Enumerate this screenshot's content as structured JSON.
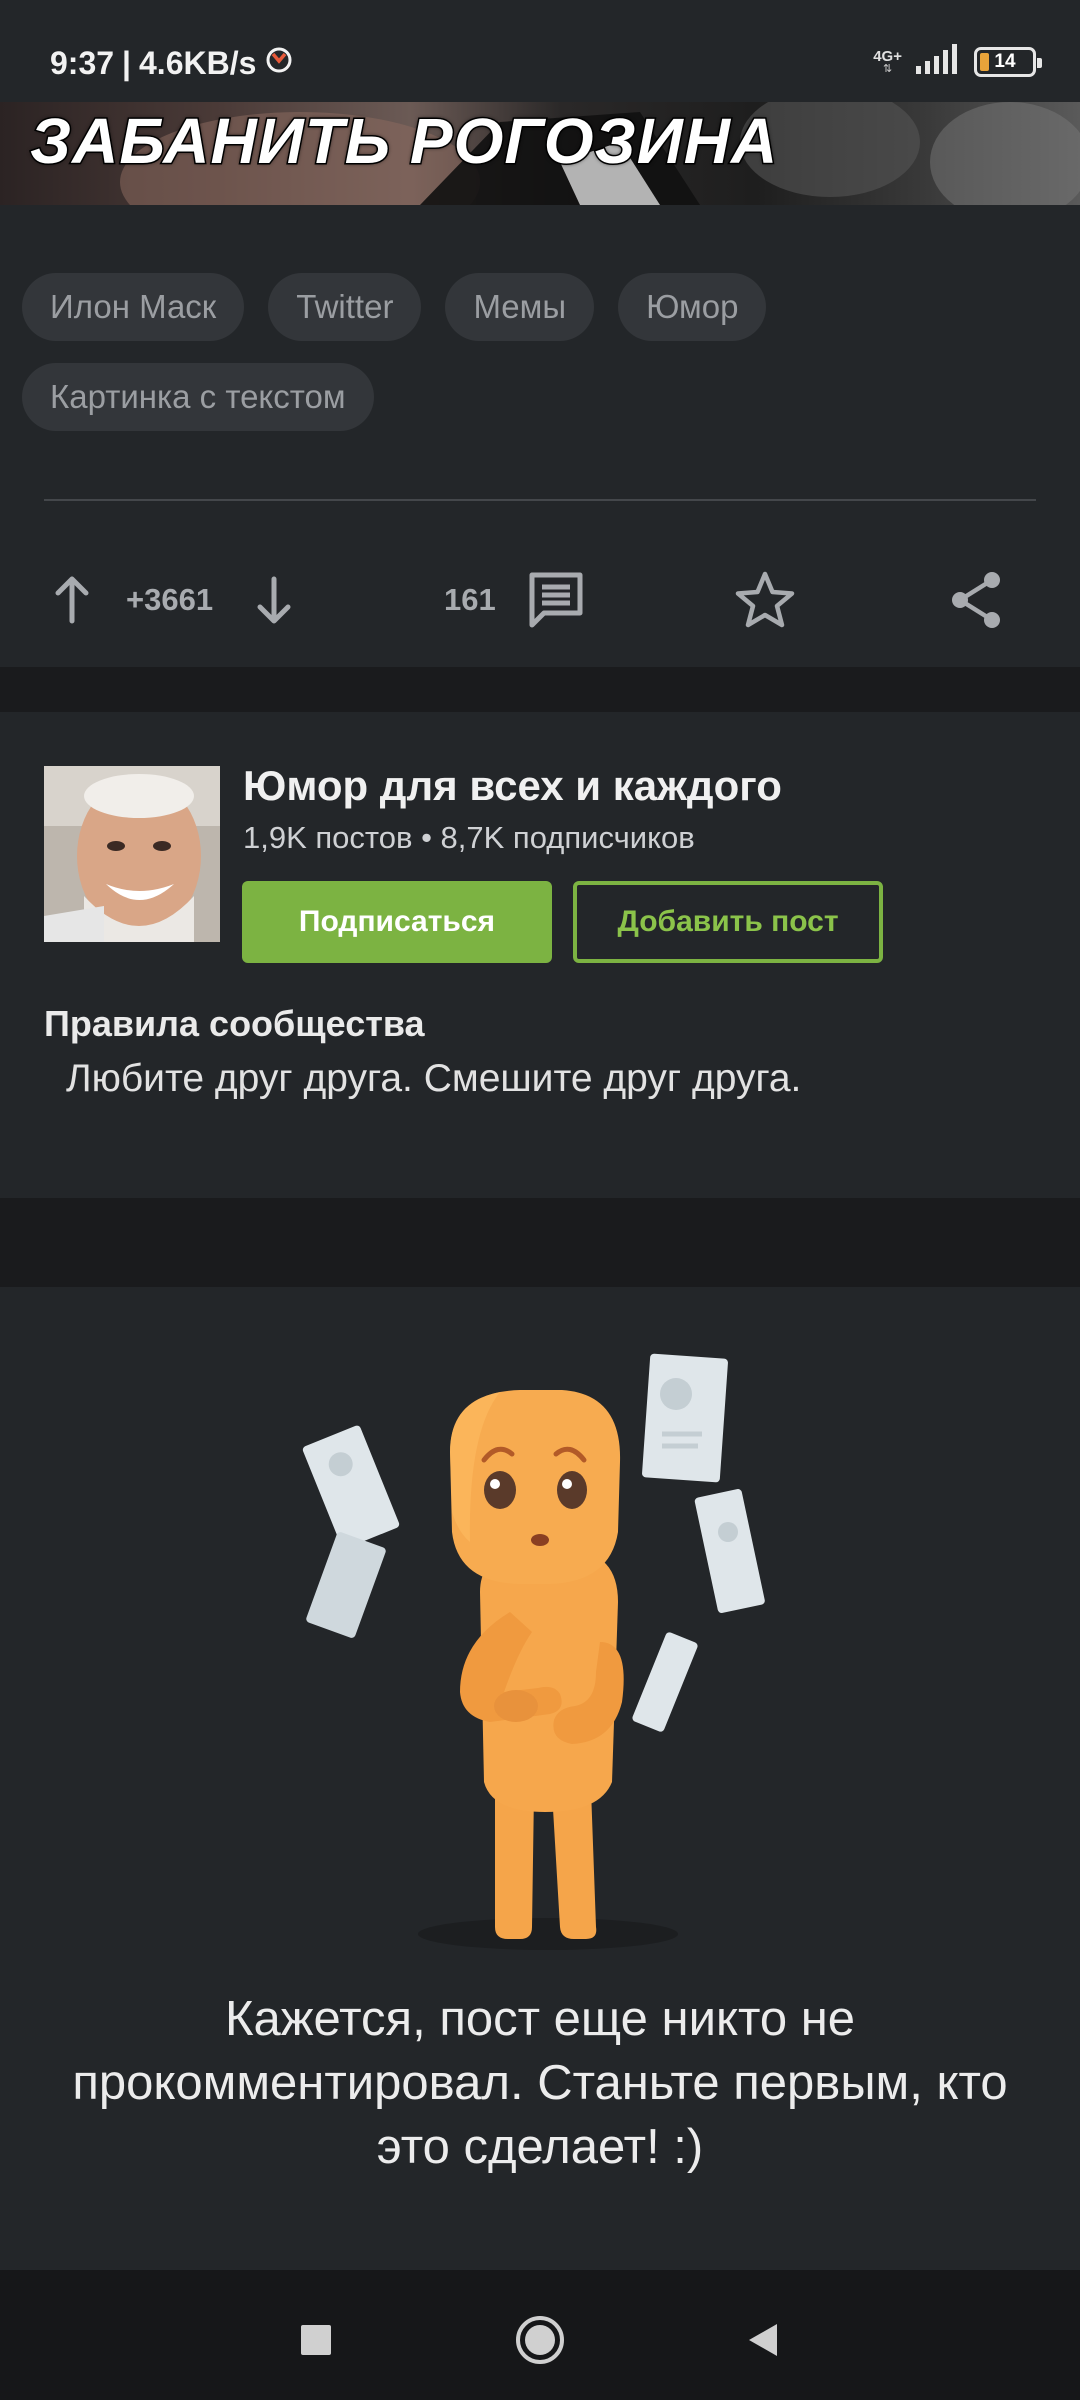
{
  "status_bar": {
    "time": "9:37",
    "speed": "4.6KB/s",
    "network": "4G+",
    "battery_level": "14",
    "battery_color": "#e8a33a"
  },
  "banner": {
    "caption": "ЗАБАНИТЬ РОГОЗИНА"
  },
  "post": {
    "tags": [
      "Илон Маск",
      "Twitter",
      "Мемы",
      "Юмор",
      "Картинка с текстом"
    ],
    "rating": "+3661",
    "comments_count": "161",
    "icons": [
      "arrow-up-icon",
      "arrow-down-icon",
      "comment-icon",
      "star-icon",
      "share-icon"
    ]
  },
  "community": {
    "title": "Юмор для всех и каждого",
    "stats": "1,9K постов • 8,7K подписчиков",
    "subscribe_label": "Подписаться",
    "add_post_label": "Добавить пост",
    "rules_title": "Правила сообщества",
    "rules_text": "Любите друг друга. Смешите друг друга.",
    "accent_color": "#7cb342"
  },
  "empty_comments": {
    "message": "Кажется, пост еще никто не прокомментировал. Станьте первым, кто это сделает! :)"
  },
  "nav_bar": {
    "icons": [
      "recent-apps-icon",
      "home-icon",
      "back-icon"
    ]
  }
}
